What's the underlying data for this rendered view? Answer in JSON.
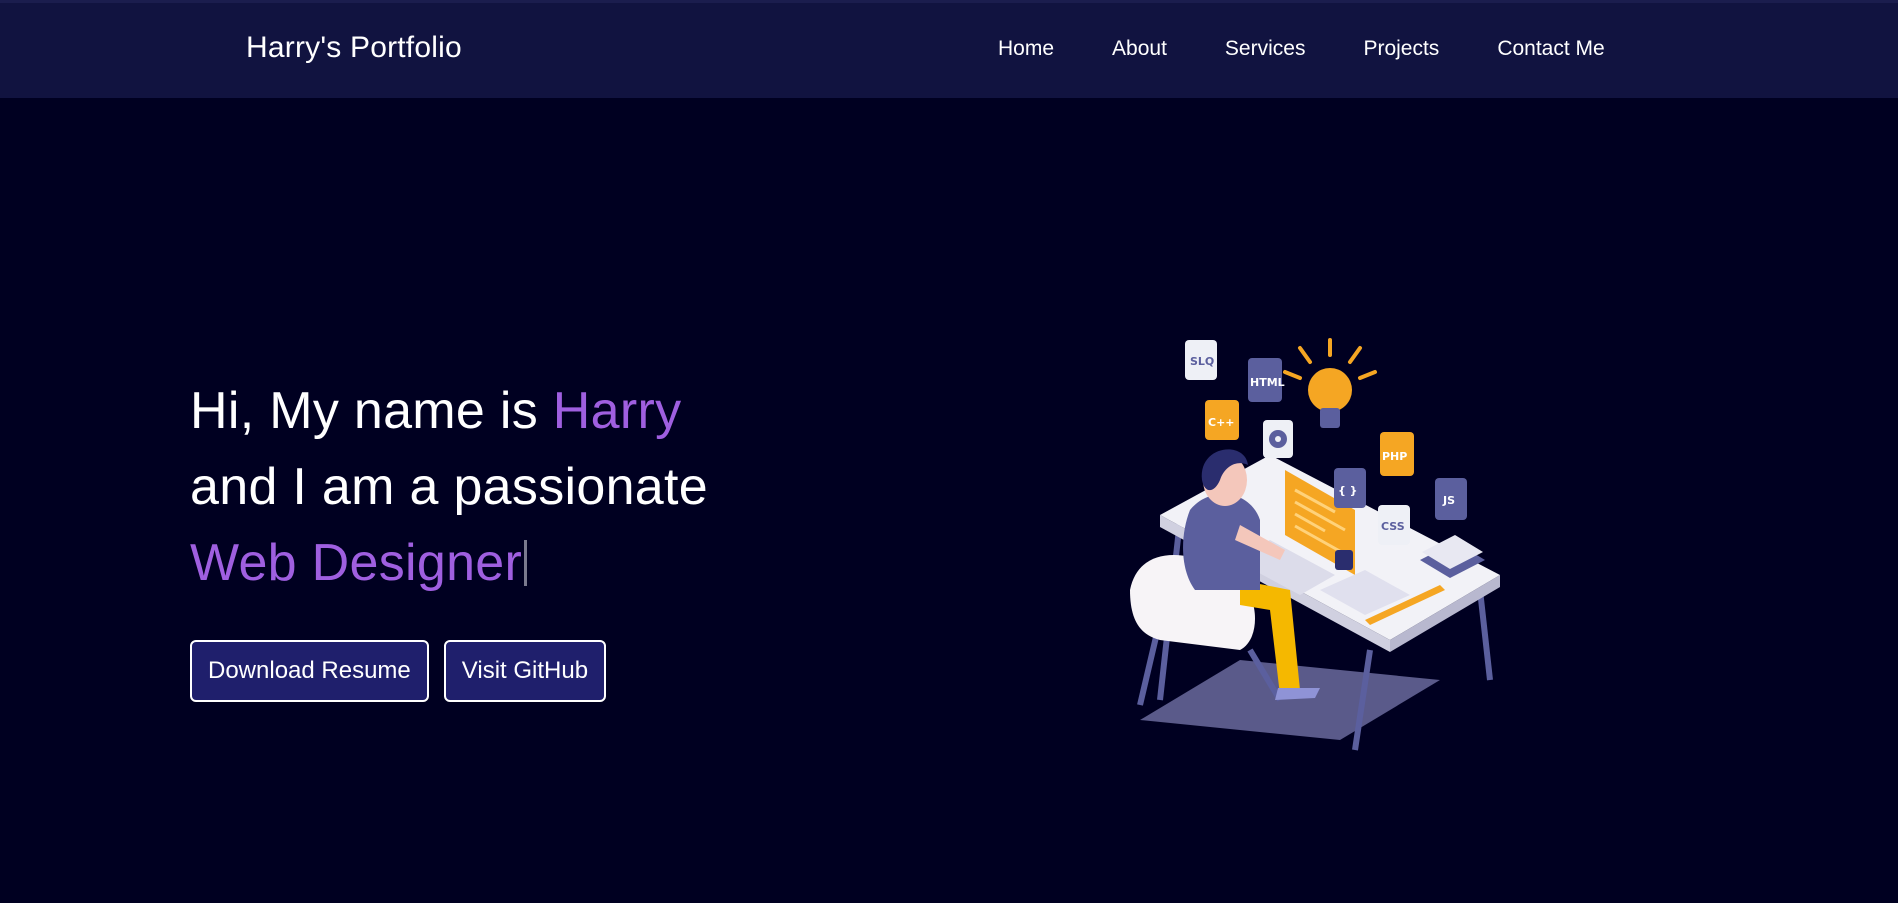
{
  "nav": {
    "brand": "Harry's Portfolio",
    "links": [
      "Home",
      "About",
      "Services",
      "Projects",
      "Contact Me"
    ]
  },
  "hero": {
    "line1_prefix": "Hi, My name is ",
    "line1_name": "Harry",
    "line2": "and I am a passionate",
    "typed_role": "Web Designer"
  },
  "buttons": {
    "download_resume": "Download Resume",
    "visit_github": "Visit GitHub"
  },
  "illustration": {
    "chips": [
      "SLQ",
      "HTML",
      "C++",
      "PHP",
      "JS",
      "CSS",
      "{ }"
    ]
  },
  "colors": {
    "background": "#000021",
    "navbar": "#111340",
    "accent_purple": "#9f5fe0",
    "button_bg": "#1f1f6c",
    "chip_orange": "#f5a623",
    "chip_slate": "#5b5f9e"
  }
}
